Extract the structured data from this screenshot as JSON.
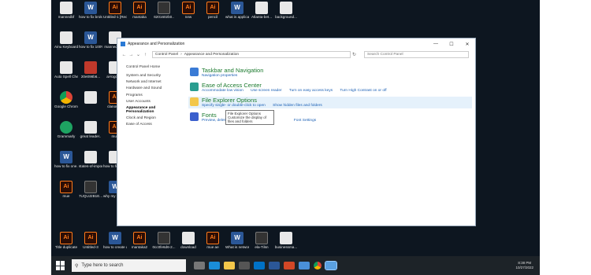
{
  "desktop_icons": [
    {
      "label": "mannedbf",
      "icon": "doc-icon"
    },
    {
      "label": "how to fix broken wpl...",
      "icon": "word-icon"
    },
    {
      "label": "Untitled-1 [Recovered]",
      "icon": "ai-icon"
    },
    {
      "label": "mantaka",
      "icon": "ai-icon"
    },
    {
      "label": "6201602b0..",
      "icon": "dark-icon"
    },
    {
      "label": "new",
      "icon": "ai-icon"
    },
    {
      "label": "pencil",
      "icon": "ai-icon"
    },
    {
      "label": "what is applicati...",
      "icon": "word-icon"
    },
    {
      "label": "Atlanta-bet...",
      "icon": "doc-icon"
    },
    {
      "label": "background...",
      "icon": "doc-icon"
    },
    {
      "label": "Ainu Keyboard",
      "icon": "doc-icon"
    },
    {
      "label": "how to fix 100% disk...",
      "icon": "word-icon"
    },
    {
      "label": "mannedbf (1)",
      "icon": "doc-icon"
    },
    {
      "label": "Auto Spell Checker",
      "icon": "doc-icon"
    },
    {
      "label": "20e098b6...",
      "icon": "red-icon"
    },
    {
      "label": "ai-logo.dm",
      "icon": "doc-icon"
    },
    {
      "label": "Google Chrome",
      "icon": "chrome-icon"
    },
    {
      "label": "",
      "icon": "doc-icon"
    },
    {
      "label": "clanout.ai",
      "icon": "ai-icon"
    },
    {
      "label": "Grammarly",
      "icon": "green-icon"
    },
    {
      "label": "great leader..",
      "icon": "doc-icon"
    },
    {
      "label": "mue",
      "icon": "ai-icon"
    },
    {
      "label": "how to fix one...",
      "icon": "word-icon"
    },
    {
      "label": "states-of-impor...",
      "icon": "doc-icon"
    },
    {
      "label": "how to fix consor disc..",
      "icon": "doc-icon"
    },
    {
      "label": "mue",
      "icon": "ai-icon"
    },
    {
      "label": "7UQUJ2B1E...",
      "icon": "dark-icon"
    },
    {
      "label": "why my cpu usage at 1...",
      "icon": "word-icon"
    },
    {
      "label": "Title duplicate",
      "icon": "ai-icon"
    },
    {
      "label": "Untitled-3",
      "icon": "ai-icon"
    },
    {
      "label": "how to create a emmer po...",
      "icon": "word-icon"
    },
    {
      "label": "mantaka2",
      "icon": "ai-icon"
    },
    {
      "label": "0cc0fe6d6-2...",
      "icon": "dark-icon"
    },
    {
      "label": "download",
      "icon": "doc-icon"
    },
    {
      "label": "mue ae",
      "icon": "ai-icon"
    },
    {
      "label": "What is network card",
      "icon": "word-icon"
    },
    {
      "label": "ela-Tilsn",
      "icon": "dark-icon"
    },
    {
      "label": "businessma...",
      "icon": "doc-icon"
    }
  ],
  "window": {
    "title": "Appearance and Personalization",
    "controls": {
      "minimize": "—",
      "maximize": "☐",
      "close": "✕"
    },
    "nav": {
      "back": "←",
      "forward": "→",
      "up": "↑",
      "refresh": "↻",
      "dropdown": "⌄"
    },
    "breadcrumb": [
      "Control Panel",
      "›",
      "Appearance and Personalization"
    ],
    "search_placeholder": "Search Control Panel"
  },
  "sidebar": {
    "home": "Control Panel Home",
    "items": [
      {
        "label": "System and Security"
      },
      {
        "label": "Network and Internet"
      },
      {
        "label": "Hardware and Sound"
      },
      {
        "label": "Programs"
      },
      {
        "label": "User Accounts"
      },
      {
        "label": "Appearance and Personalization"
      },
      {
        "label": "Clock and Region"
      },
      {
        "label": "Ease of Access"
      }
    ]
  },
  "categories": [
    {
      "title": "Taskbar and Navigation",
      "links": [
        "Navigation properties"
      ],
      "color": "#3a7bd5"
    },
    {
      "title": "Ease of Access Center",
      "links": [
        "Accommodate low vision",
        "Use screen reader",
        "Turn on easy access keys",
        "Turn High Contrast on or off"
      ],
      "color": "#2a9d8f"
    },
    {
      "title": "File Explorer Options",
      "links": [
        "Specify single- or double-click to open",
        "Show hidden files and folders"
      ],
      "color": "#f3c74a"
    },
    {
      "title": "Fonts",
      "links": [
        "Preview, delete",
        "Font Settings"
      ],
      "color": "#3a5fcd"
    }
  ],
  "tooltip": {
    "title": "File Explorer Options",
    "text": "Customize the display of files and folders"
  },
  "taskbar": {
    "search_placeholder": "Type here to search",
    "time": "8:38 PM",
    "date": "10/27/2022"
  }
}
